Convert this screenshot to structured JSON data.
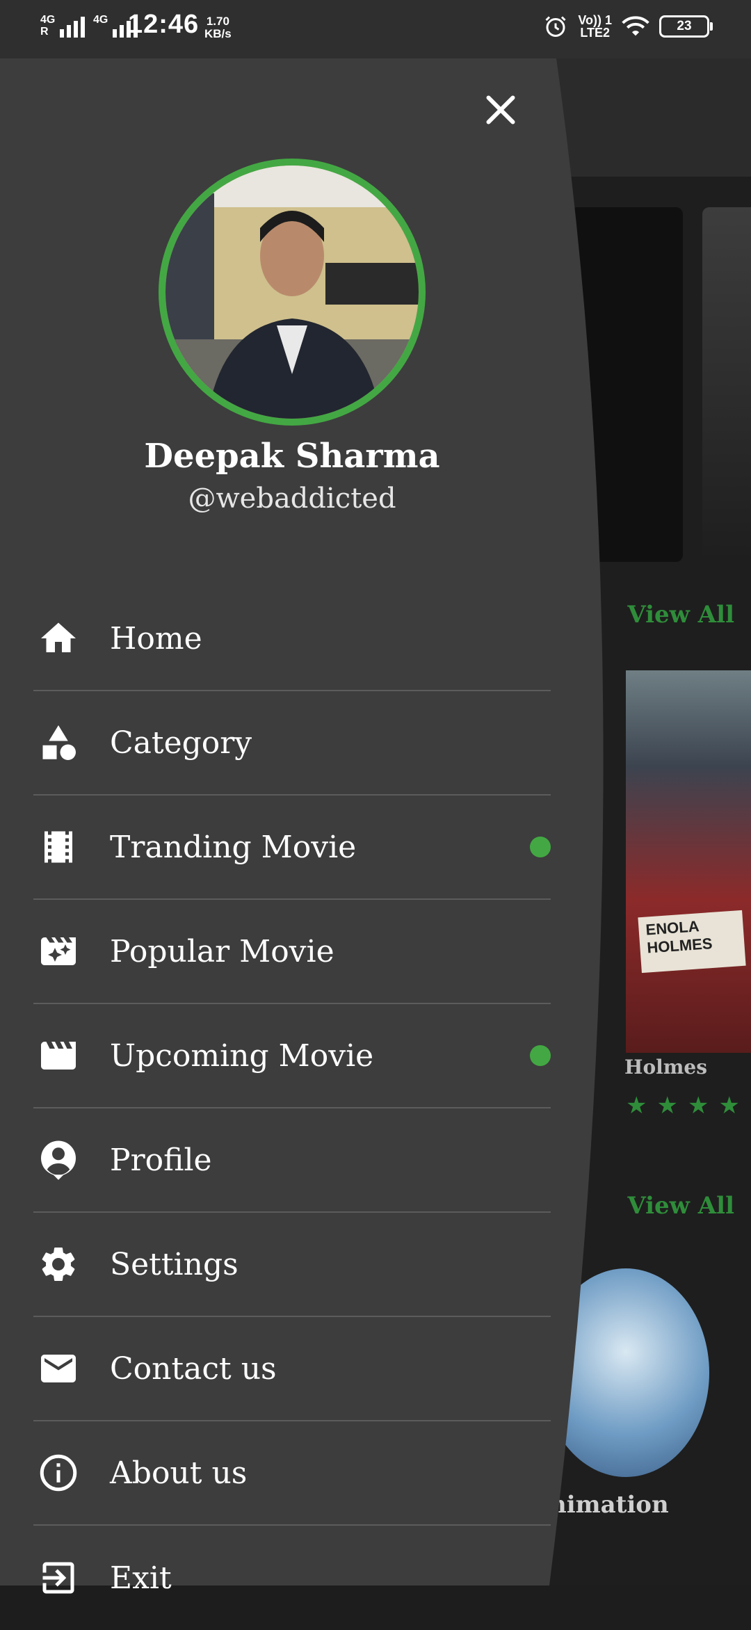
{
  "status_bar": {
    "net1_label": "4G",
    "net1_sub": "R",
    "net2_label": "4G",
    "time": "12:46",
    "speed_value": "1.70",
    "speed_unit": "KB/s",
    "volte_line1": "Vo)) 1",
    "volte_line2": "LTE2",
    "battery": "23"
  },
  "background": {
    "view_all_1": "View All",
    "view_all_2": "View All",
    "poster_sign": "ENOLA HOLMES",
    "poster_title": "Holmes",
    "rating_stars": "★★★★",
    "category_label": "nimation"
  },
  "drawer": {
    "user": {
      "name": "Deepak Sharma",
      "handle": "@webaddicted"
    },
    "accent_color": "#43a843",
    "items": [
      {
        "label": "Home",
        "icon": "home-icon",
        "badge": false
      },
      {
        "label": "Category",
        "icon": "category-icon",
        "badge": false
      },
      {
        "label": "Tranding Movie",
        "icon": "film-strip-icon",
        "badge": true
      },
      {
        "label": "Popular Movie",
        "icon": "movie-filter-icon",
        "badge": false
      },
      {
        "label": "Upcoming Movie",
        "icon": "movie-clapper-icon",
        "badge": true
      },
      {
        "label": "Profile",
        "icon": "profile-icon",
        "badge": false
      },
      {
        "label": "Settings",
        "icon": "gear-icon",
        "badge": false
      },
      {
        "label": "Contact us",
        "icon": "mail-icon",
        "badge": false
      },
      {
        "label": "About us",
        "icon": "info-icon",
        "badge": false
      },
      {
        "label": "Exit",
        "icon": "exit-icon",
        "badge": false
      }
    ]
  }
}
